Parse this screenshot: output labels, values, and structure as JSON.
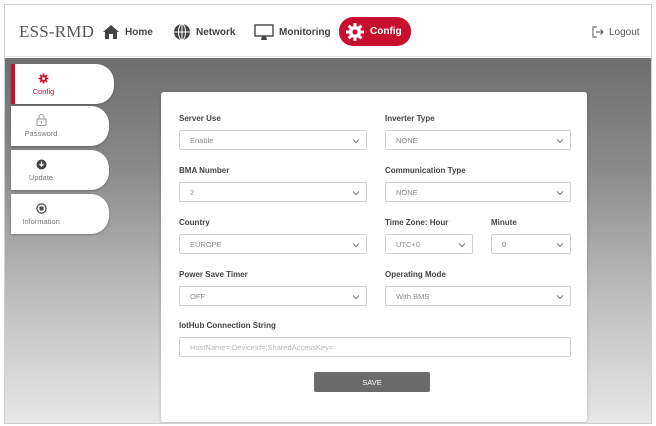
{
  "header": {
    "brand": "ESS-RMD",
    "nav": {
      "home": "Home",
      "network": "Network",
      "monitoring": "Monitoring",
      "config": "Config",
      "logout": "Logout"
    }
  },
  "sidebar": {
    "items": [
      {
        "label": "Config",
        "icon": "gear-icon",
        "active": true
      },
      {
        "label": "Password",
        "icon": "lock-icon",
        "active": false
      },
      {
        "label": "Update",
        "icon": "update-icon",
        "active": false
      },
      {
        "label": "Information",
        "icon": "info-icon",
        "active": false
      }
    ]
  },
  "form": {
    "server_use": {
      "label": "Server Use",
      "value": "Enable"
    },
    "inverter_type": {
      "label": "Inverter Type",
      "value": "NONE"
    },
    "bma_number": {
      "label": "BMA Number",
      "value": "2"
    },
    "communication_type": {
      "label": "Communication Type",
      "value": "NONE"
    },
    "country": {
      "label": "Country",
      "value": "EUROPE"
    },
    "time_zone_hour": {
      "label": "Time Zone: Hour",
      "value": "UTC+0"
    },
    "minute": {
      "label": "Minute",
      "value": "0"
    },
    "power_save_timer": {
      "label": "Power Save Timer",
      "value": "OFF"
    },
    "operating_mode": {
      "label": "Operating Mode",
      "value": "With BMS"
    },
    "iothub": {
      "label": "IotHub Connection String",
      "placeholder": "HostName=;DeviceId=;SharedAccessKey="
    },
    "save_label": "SAVE"
  },
  "colors": {
    "accent": "#c8102e",
    "save_button": "#6b6b6b"
  }
}
